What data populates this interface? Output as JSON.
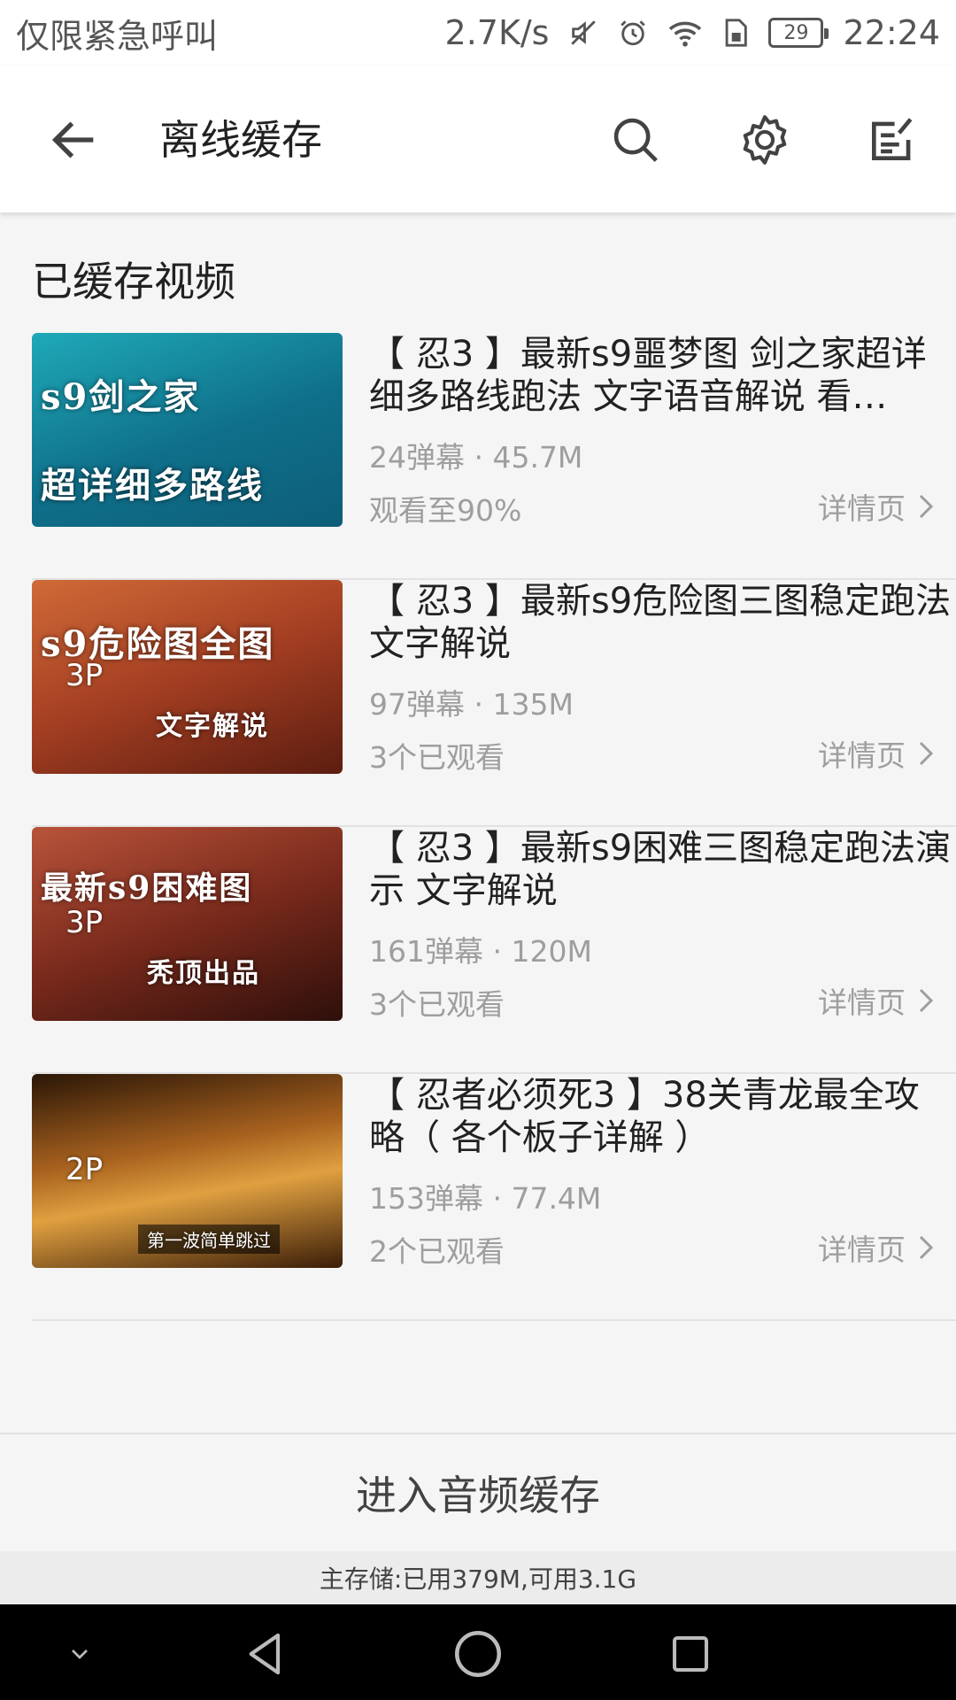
{
  "status_bar": {
    "carrier": "仅限紧急呼叫",
    "speed": "2.7K/s",
    "battery": "29",
    "time": "22:24"
  },
  "app_bar": {
    "title": "离线缓存",
    "icons": [
      "back-arrow-icon",
      "search-icon",
      "gear-icon",
      "edit-list-icon"
    ]
  },
  "section": {
    "title": "已缓存视频"
  },
  "videos": [
    {
      "title": "【 忍3 】最新s9噩梦图 剑之家超详细多路线跑法 文字语音解说 看…",
      "meta": "24弹幕 · 45.7M",
      "progress": "观看至90%",
      "detail": "详情页",
      "thumb_line1": "s9剑之家",
      "thumb_line2": "超详细多路线",
      "parts": "",
      "colors": [
        "#1fa9b8",
        "#0d5e78"
      ]
    },
    {
      "title": "【 忍3 】最新s9危险图三图稳定跑法 文字解说",
      "meta": "97弹幕 · 135M",
      "progress": "3个已观看",
      "detail": "详情页",
      "thumb_line1": "s9危险图全图",
      "thumb_line2": "文字解说",
      "parts": "3P",
      "colors": [
        "#c0562f",
        "#6e2414"
      ]
    },
    {
      "title": "【 忍3 】最新s9困难三图稳定跑法演示 文字解说",
      "meta": "161弹幕 · 120M",
      "progress": "3个已观看",
      "detail": "详情页",
      "thumb_line1": "最新s9困难图",
      "thumb_line2": "秃顶出品",
      "parts": "3P",
      "colors": [
        "#a8452c",
        "#3a120e"
      ]
    },
    {
      "title": "【 忍者必须死3 】38关青龙最全攻略（ 各个板子详解 ）",
      "meta": "153弹幕 · 77.4M",
      "progress": "2个已观看",
      "detail": "详情页",
      "thumb_line1": "",
      "thumb_line2": "第一波简单跳过",
      "parts": "2P",
      "colors": [
        "#d9922e",
        "#3a1d08"
      ]
    }
  ],
  "audio_cache": "进入音频缓存",
  "storage": "主存储:已用379M,可用3.1G"
}
